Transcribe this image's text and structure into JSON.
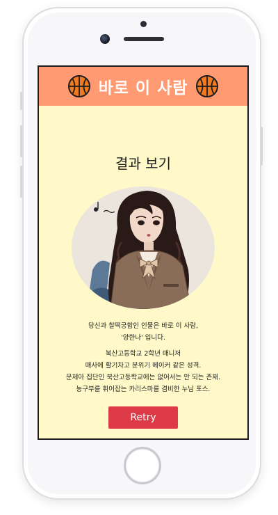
{
  "app": {
    "title": "바로 이 사람"
  },
  "result": {
    "heading": "결과 보기",
    "intro_line1": "당신과 찰떡궁합인 인물은 바로 이 사람,",
    "intro_line2": "'양한나' 입니다.",
    "detail_line1": "북산고등학교 2학년 매니저",
    "detail_line2": "매사에 활기차고 분위기 메이커 같은 성격.",
    "detail_line3": "문제아 집단인 북산고등학교에는 없어서는 안 되는 존재.",
    "detail_line4": "농구부를 휘어잡는 카리스마를 겸비한 누님 포스."
  },
  "actions": {
    "retry_label": "Retry"
  },
  "icons": {
    "header_left": "basketball-icon",
    "header_right": "basketball-icon"
  },
  "colors": {
    "header_bg": "#ff9a72",
    "content_bg": "#fff8c8",
    "retry_bg": "#dd3a48"
  }
}
